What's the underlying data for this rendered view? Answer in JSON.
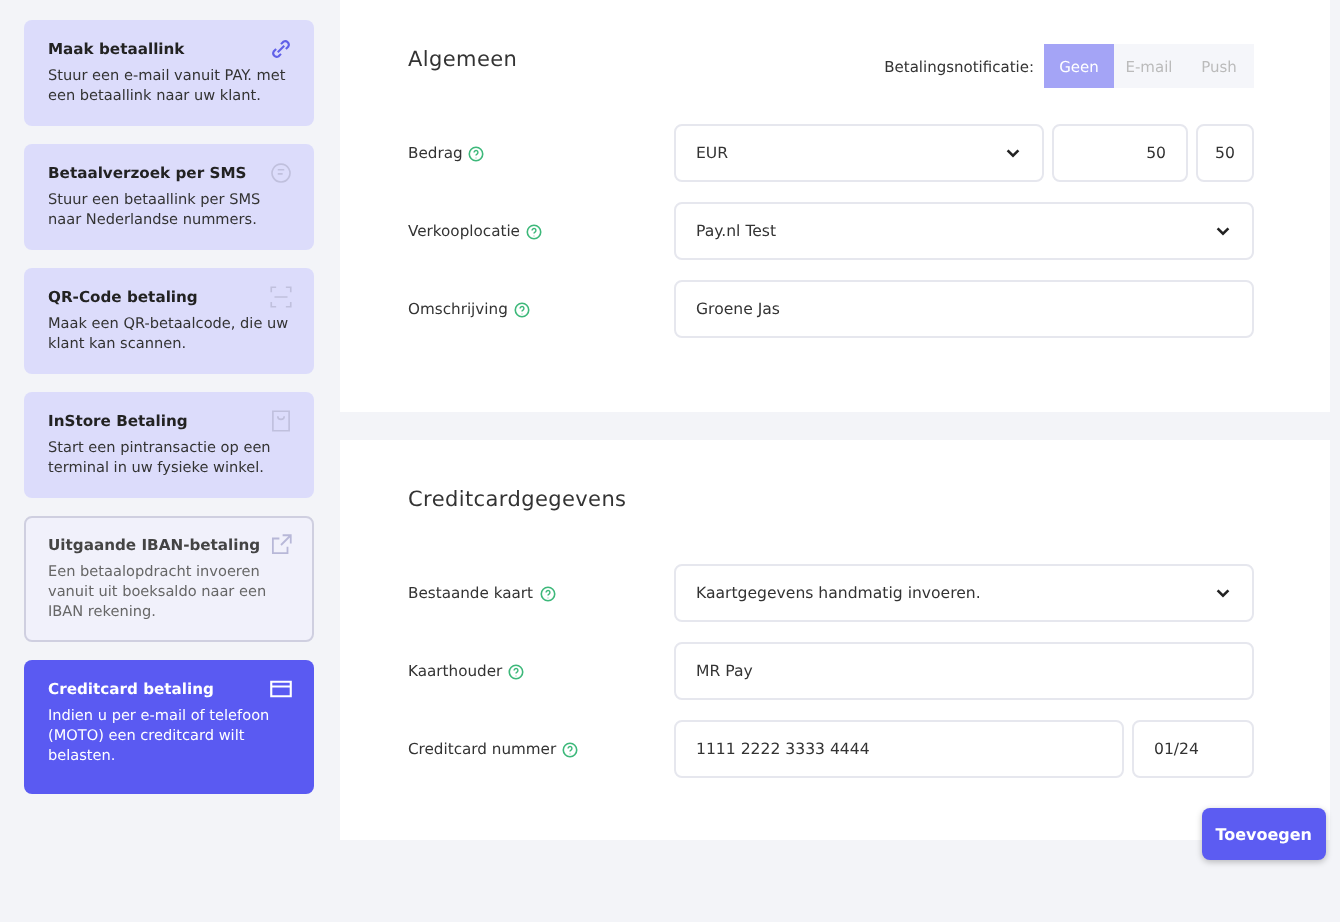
{
  "sidebar": {
    "items": [
      {
        "title": "Maak betaallink",
        "description": "Stuur een e-mail vanuit PAY. met een betaallink naar uw klant.",
        "selected": false,
        "disabled": false
      },
      {
        "title": "Betaalverzoek per SMS",
        "description": "Stuur een betaallink per SMS naar Nederlandse nummers.",
        "selected": false,
        "disabled": false
      },
      {
        "title": "QR-Code betaling",
        "description": "Maak een QR-betaalcode, die uw klant kan scannen.",
        "selected": false,
        "disabled": false
      },
      {
        "title": "InStore Betaling",
        "description": "Start een pintransactie op een terminal in uw fysieke winkel.",
        "selected": false,
        "disabled": false
      },
      {
        "title": "Uitgaande IBAN-betaling",
        "description": "Een betaalopdracht invoeren vanuit uit boeksaldo naar een IBAN rekening.",
        "selected": false,
        "disabled": true
      },
      {
        "title": "Creditcard betaling",
        "description": "Indien u per e-mail of telefoon (MOTO) een creditcard wilt belasten.",
        "selected": true,
        "disabled": false
      }
    ]
  },
  "sections": [
    {
      "title": "Algemeen",
      "notification": {
        "label": "Betalingsnotificatie:",
        "options": [
          {
            "label": "Geen",
            "selected": true
          },
          {
            "label": "E-mail",
            "selected": false
          },
          {
            "label": "Push",
            "selected": false
          }
        ]
      },
      "rows": [
        {
          "label": "Bedrag",
          "fields": [
            {
              "kind": "select",
              "value": "EUR"
            },
            {
              "kind": "amount",
              "value": "50"
            },
            {
              "kind": "small",
              "value": "50"
            }
          ]
        },
        {
          "label": "Verkooplocatie",
          "fields": [
            {
              "kind": "select",
              "value": "Pay.nl Test"
            }
          ]
        },
        {
          "label": "Omschrijving",
          "fields": [
            {
              "kind": "input",
              "value": "Groene Jas"
            }
          ]
        }
      ]
    },
    {
      "title": "Creditcardgegevens",
      "rows": [
        {
          "label": "Bestaande kaart",
          "fields": [
            {
              "kind": "select",
              "value": "Kaartgegevens handmatig invoeren."
            }
          ]
        },
        {
          "label": "Kaarthouder",
          "fields": [
            {
              "kind": "input",
              "value": "MR Pay"
            }
          ]
        },
        {
          "label": "Creditcard nummer",
          "fields": [
            {
              "kind": "input",
              "value": "1111 2222 3333 4444"
            },
            {
              "kind": "expiry",
              "value": "01/24"
            }
          ]
        }
      ]
    }
  ],
  "submit_button": "Toevoegen"
}
